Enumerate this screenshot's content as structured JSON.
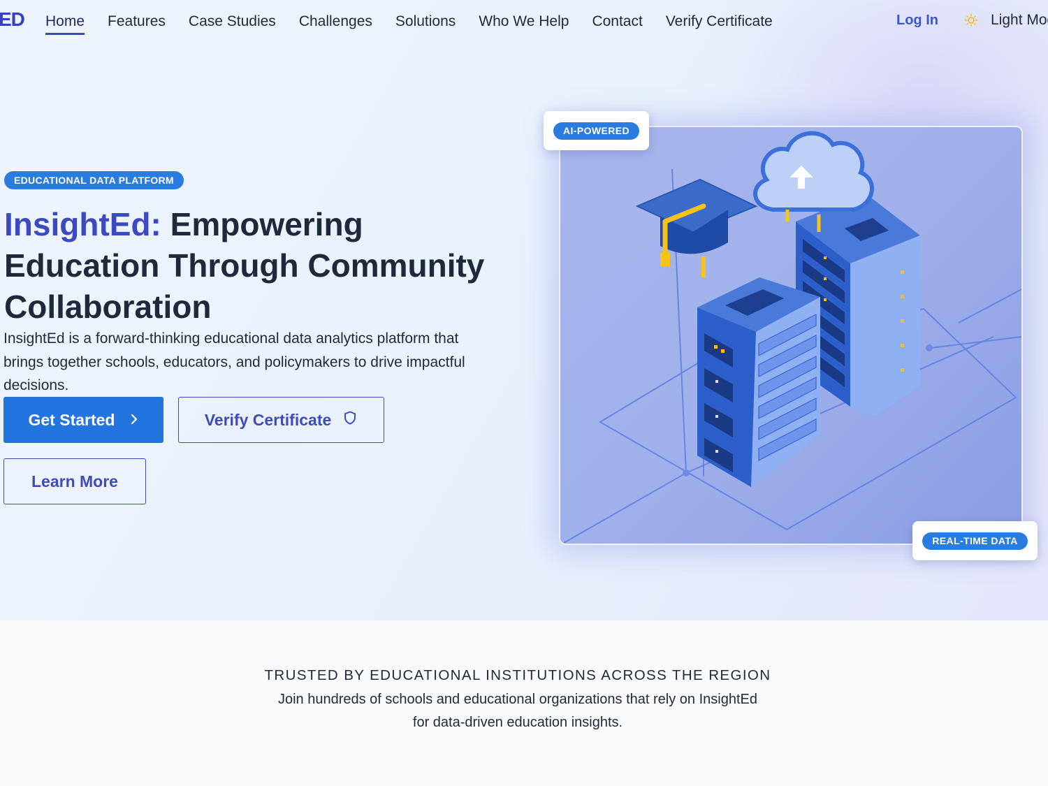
{
  "nav": {
    "logo": "ED",
    "links": [
      "Home",
      "Features",
      "Case Studies",
      "Challenges",
      "Solutions",
      "Who We Help",
      "Contact",
      "Verify Certificate"
    ],
    "login": "Log In",
    "mode_label": "Light Mode",
    "mode_icon": "sun-icon"
  },
  "hero": {
    "badge": "EDUCATIONAL DATA PLATFORM",
    "title_brand": "InsightEd:",
    "title_rest": " Empowering Education Through Community Collaboration",
    "description": "InsightEd is a forward-thinking educational data analytics platform that brings together schools, educators, and policymakers to drive impactful decisions.",
    "buttons": {
      "get_started": "Get Started",
      "verify": "Verify Certificate",
      "learn_more": "Learn More"
    },
    "tags": {
      "ai": "AI-POWERED",
      "realtime": "REAL-TIME DATA"
    }
  },
  "trusted": {
    "title": "TRUSTED BY EDUCATIONAL INSTITUTIONS ACROSS THE REGION",
    "description": "Join hundreds of schools and educational organizations that rely on InsightEd for data-driven education insights."
  },
  "colors": {
    "primary": "#2374df",
    "brand": "#3c4ac0",
    "accent_yellow": "#f7c21a"
  }
}
